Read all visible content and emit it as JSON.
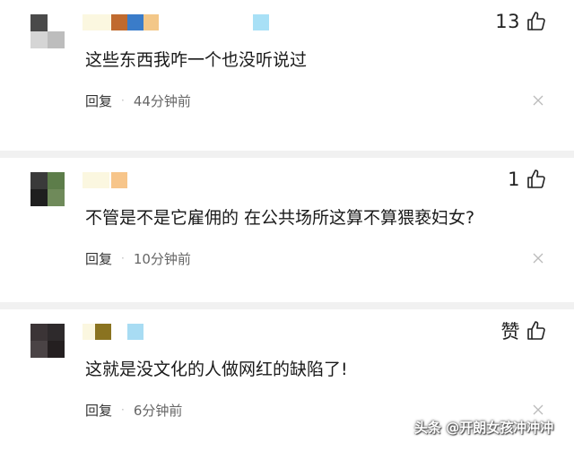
{
  "comments": [
    {
      "content": "这些东西我咋一个也没听说过",
      "likes": "13",
      "reply_label": "回复",
      "separator": "·",
      "time": "44分钟前",
      "avatar_colors": [
        "#4a4a4a",
        "#ffffff",
        "#d5d5d5",
        "#bdbdbd"
      ],
      "username_colors": [
        "#fbf7e0",
        "#c06a2e",
        "#3a7cc9",
        "#f3c788",
        "#a8e0f6"
      ]
    },
    {
      "content": "不管是不是它雇佣的 在公共场所这算不算猥亵妇女?",
      "likes": "1",
      "reply_label": "回复",
      "separator": "·",
      "time": "10分钟前",
      "avatar_colors": [
        "#3a3a3a",
        "#5d7d4a",
        "#1f1f1f",
        "#6f8a5a"
      ],
      "username_colors": [
        "#fbf7e0",
        "#f7c58a"
      ]
    },
    {
      "content": "这就是没文化的人做网红的缺陷了!",
      "likes": "赞",
      "reply_label": "回复",
      "separator": "·",
      "time": "6分钟前",
      "avatar_colors": [
        "#3b3436",
        "#2e2a2c",
        "#4a4345",
        "#241f20"
      ],
      "username_colors": [
        "#fbf7e0",
        "#8a7320",
        "#a8dcf3"
      ]
    }
  ],
  "icons": {
    "like": "thumbs-up-icon",
    "close": "close-icon"
  },
  "watermark": "头条 @开朗女孩冲冲冲"
}
